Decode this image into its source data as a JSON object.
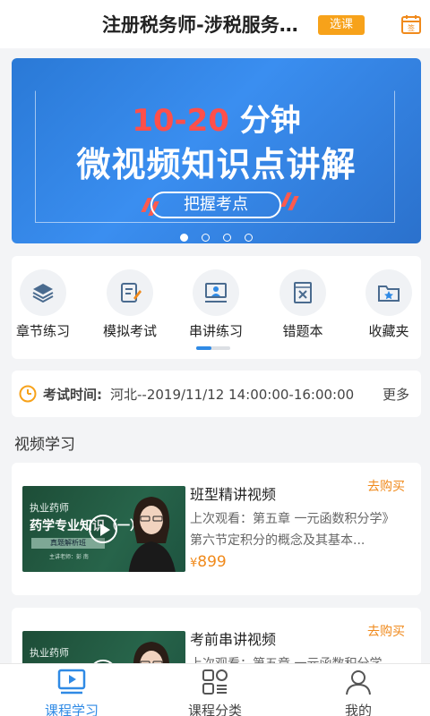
{
  "header": {
    "title": "注册税务师-涉税服务…",
    "select_label": "选课",
    "icon": "sign-in-calendar-icon"
  },
  "banner": {
    "headline_red": "10-20",
    "headline_white": "分钟",
    "headline2": "微视频知识点讲解",
    "pill_label": "把握考点",
    "dots": 4,
    "active_dot": 0
  },
  "quick_menu": [
    {
      "label": "章节练习",
      "icon": "layers-icon"
    },
    {
      "label": "模拟考试",
      "icon": "edit-paper-icon"
    },
    {
      "label": "串讲练习",
      "icon": "presentation-icon"
    },
    {
      "label": "错题本",
      "icon": "wrong-answer-book-icon"
    },
    {
      "label": "收藏夹",
      "icon": "star-folder-icon"
    }
  ],
  "exam": {
    "label": "考试时间:",
    "value": "河北--2019/11/12  14:00:00-16:00:00",
    "more": "更多"
  },
  "section_title": "视频学习",
  "courses": [
    {
      "title": "班型精讲视频",
      "buy": "去购买",
      "desc_line1": "上次观看：第五章 一元函数积分学》",
      "desc_line2": "第六节定积分的概念及其基本...",
      "price_symbol": "¥",
      "price": "899",
      "thumb": {
        "tag": "执业药师",
        "title": "药学专业知识（一）",
        "subtitle": "真题解析班",
        "teacher": "主讲老师：彭 南"
      }
    },
    {
      "title": "考前串讲视频",
      "buy": "去购买",
      "desc_line1": "上次观看：第五章 一元函数积分学...",
      "desc_line2": "",
      "price_symbol": "",
      "price": "",
      "thumb": {
        "tag": "执业药师",
        "title": "",
        "subtitle": "",
        "teacher": ""
      }
    }
  ],
  "bottom_nav": [
    {
      "label": "课程学习",
      "icon": "video-play-icon",
      "active": true
    },
    {
      "label": "课程分类",
      "icon": "category-grid-icon",
      "active": false
    },
    {
      "label": "我的",
      "icon": "user-profile-icon",
      "active": false
    }
  ],
  "colors": {
    "accent": "#2f8ae5",
    "orange": "#f08a1c",
    "select_button": "#f7a21a",
    "banner_blue": "#3a8ef0",
    "banner_red": "#ff4f4a"
  }
}
